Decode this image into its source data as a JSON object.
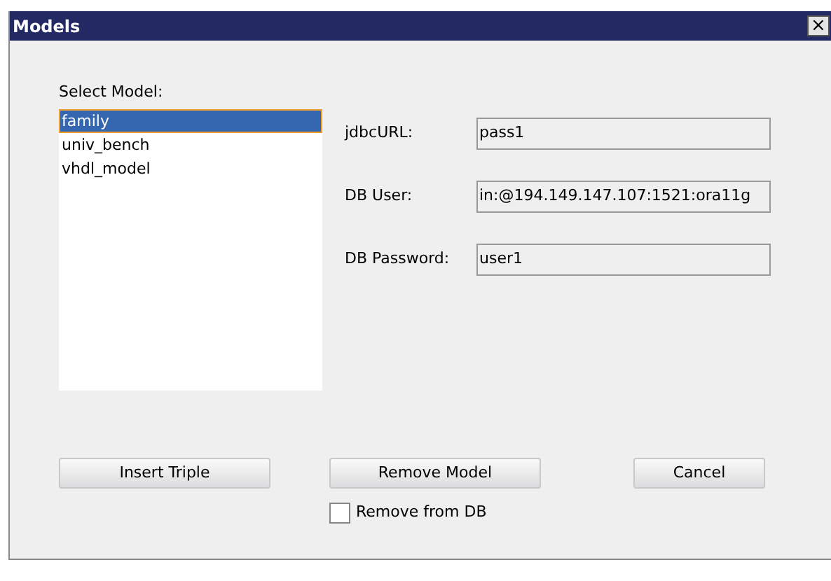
{
  "window": {
    "title": "Models",
    "close": "×"
  },
  "model_list": {
    "label": "Select Model:",
    "items": [
      {
        "label": "family",
        "selected": true
      },
      {
        "label": "univ_bench",
        "selected": false
      },
      {
        "label": "vhdl_model",
        "selected": false
      }
    ]
  },
  "fields": [
    {
      "label": "jdbcURL:",
      "value": "pass1"
    },
    {
      "label": "DB User:",
      "value": "in:@194.149.147.107:1521:ora11g"
    },
    {
      "label": "DB Password:",
      "value": "user1"
    }
  ],
  "buttons": [
    "Insert Triple",
    "Remove Model",
    "Cancel"
  ],
  "remove_from_db": {
    "label": "Remove from DB",
    "checked": false
  }
}
